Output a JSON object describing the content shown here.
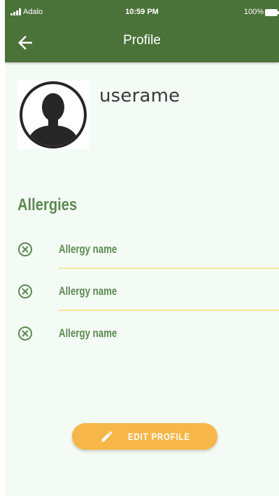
{
  "status_bar": {
    "carrier": "Adalo",
    "time": "10:59 PM",
    "battery": "100%"
  },
  "app_bar": {
    "title": "Profile",
    "back_icon": "arrow-left-icon"
  },
  "profile": {
    "avatar_icon": "person-silhouette-icon",
    "username": "userame"
  },
  "allergies": {
    "title": "Allergies",
    "remove_icon": "close-circle-icon",
    "items": [
      {
        "name": "Allergy name"
      },
      {
        "name": "Allergy name"
      },
      {
        "name": "Allergy name"
      }
    ]
  },
  "actions": {
    "edit_label": "EDIT PROFILE",
    "edit_icon": "pencil-icon"
  },
  "colors": {
    "header_green": "#4b7239",
    "accent_green": "#5c8a52",
    "background": "#f4fbf4",
    "button_orange": "#f6b648",
    "divider_yellow": "#f2e59a"
  }
}
